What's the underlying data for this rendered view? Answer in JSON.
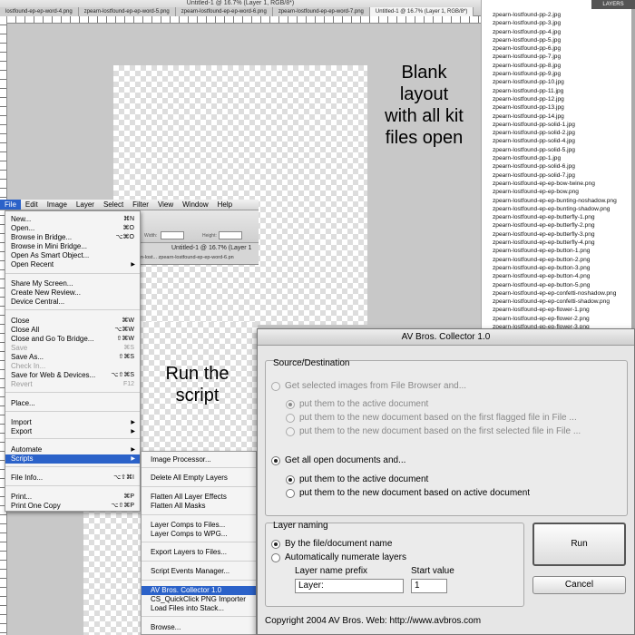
{
  "app": {
    "window_title": "Untitled-1 @ 16.7% (Layer 1, RGB/8*)",
    "tabs": [
      "lostfound-ep-ep-word-4.png",
      "zpearn-lostfound-ep-ep-word-5.png",
      "zpearn-lostfound-ep-ep-word-6.png",
      "zpearn-lostfound-ep-ep-word-7.png",
      "Untitled-1 @ 16.7% (Layer 1, RGB/8*)"
    ],
    "layers_tab": "LAYERS"
  },
  "annotations": {
    "blank_layout_lines": [
      "Blank",
      "layout",
      "with all kit",
      "files open"
    ],
    "run_script_lines": [
      "Run the",
      "script"
    ]
  },
  "open_files": [
    "zpearn-lostfound-pp-2.jpg",
    "zpearn-lostfound-pp-3.jpg",
    "zpearn-lostfound-pp-4.jpg",
    "zpearn-lostfound-pp-5.jpg",
    "zpearn-lostfound-pp-6.jpg",
    "zpearn-lostfound-pp-7.jpg",
    "zpearn-lostfound-pp-8.jpg",
    "zpearn-lostfound-pp-9.jpg",
    "zpearn-lostfound-pp-10.jpg",
    "zpearn-lostfound-pp-11.jpg",
    "zpearn-lostfound-pp-12.jpg",
    "zpearn-lostfound-pp-13.jpg",
    "zpearn-lostfound-pp-14.jpg",
    "zpearn-lostfound-pp-solid-1.jpg",
    "zpearn-lostfound-pp-solid-2.jpg",
    "zpearn-lostfound-pp-solid-4.jpg",
    "zpearn-lostfound-pp-solid-5.jpg",
    "zpearn-lostfound-pp-1.jpg",
    "zpearn-lostfound-pp-solid-6.jpg",
    "zpearn-lostfound-pp-solid-7.jpg",
    "zpearn-lostfound-ep-ep-bow-twine.png",
    "zpearn-lostfound-ep-ep-bow.png",
    "zpearn-lostfound-ep-ep-bunting-noshadow.png",
    "zpearn-lostfound-ep-ep-bunting-shadow.png",
    "zpearn-lostfound-ep-ep-butterfly-1.png",
    "zpearn-lostfound-ep-ep-butterfly-2.png",
    "zpearn-lostfound-ep-ep-butterfly-3.png",
    "zpearn-lostfound-ep-ep-butterfly-4.png",
    "zpearn-lostfound-ep-ep-button-1.png",
    "zpearn-lostfound-ep-ep-button-2.png",
    "zpearn-lostfound-ep-ep-button-3.png",
    "zpearn-lostfound-ep-ep-button-4.png",
    "zpearn-lostfound-ep-ep-button-5.png",
    "zpearn-lostfound-ep-ep-confetti-noshadow.png",
    "zpearn-lostfound-ep-ep-confetti-shadow.png",
    "zpearn-lostfound-ep-ep-flower-1.png",
    "zpearn-lostfound-ep-ep-flower-2.png",
    "zpearn-lostfound-ep-ep-flower-3.png",
    "zpearn-lostfound-ep-ep-flower-4.png",
    "zpearn-lostfound-ep-ep-flower-5.png",
    "zpearn-lostfound-ep-ep-flower-6.png"
  ],
  "menubar": [
    "File",
    "Edit",
    "Image",
    "Layer",
    "Select",
    "Filter",
    "View",
    "Window",
    "Help"
  ],
  "options_bar": {
    "width_label": "Width:",
    "height_label": "Height:"
  },
  "second_window": {
    "title": "Untitled-1 @ 16.7% (Layer 1",
    "tabs": "n-lost...  zpearn-lostfound-ep-ep-word-6.pn"
  },
  "file_menu": [
    {
      "label": "New...",
      "shortcut": "⌘N"
    },
    {
      "label": "Open...",
      "shortcut": "⌘O"
    },
    {
      "label": "Browse in Bridge...",
      "shortcut": "⌥⌘O"
    },
    {
      "label": "Browse in Mini Bridge..."
    },
    {
      "label": "Open As Smart Object..."
    },
    {
      "label": "Open Recent",
      "submenu": true
    },
    {
      "label": "Share My Screen..."
    },
    {
      "label": "Create New Review..."
    },
    {
      "label": "Device Central..."
    },
    {
      "label": "Close",
      "shortcut": "⌘W"
    },
    {
      "label": "Close All",
      "shortcut": "⌥⌘W"
    },
    {
      "label": "Close and Go To Bridge...",
      "shortcut": "⇧⌘W"
    },
    {
      "label": "Save",
      "shortcut": "⌘S",
      "disabled": true
    },
    {
      "label": "Save As...",
      "shortcut": "⇧⌘S"
    },
    {
      "label": "Check In...",
      "disabled": true
    },
    {
      "label": "Save for Web & Devices...",
      "shortcut": "⌥⇧⌘S"
    },
    {
      "label": "Revert",
      "shortcut": "F12",
      "disabled": true
    },
    {
      "label": "Place..."
    },
    {
      "label": "Import",
      "submenu": true
    },
    {
      "label": "Export",
      "submenu": true
    },
    {
      "label": "Automate",
      "submenu": true
    },
    {
      "label": "Scripts",
      "submenu": true,
      "selected": true
    },
    {
      "label": "File Info...",
      "shortcut": "⌥⇧⌘I"
    },
    {
      "label": "Print...",
      "shortcut": "⌘P"
    },
    {
      "label": "Print One Copy",
      "shortcut": "⌥⇧⌘P"
    }
  ],
  "scripts_menu": [
    "Image Processor...",
    "Delete All Empty Layers",
    "Flatten All Layer Effects",
    "Flatten All Masks",
    "Layer Comps to Files...",
    "Layer Comps to WPG...",
    "Export Layers to Files...",
    "Script Events Manager...",
    "AV Bros. Collector 1.0",
    "CS_QuickClick PNG Importer",
    "Load Files into Stack...",
    "Browse..."
  ],
  "dialog": {
    "title": "AV Bros. Collector 1.0",
    "source_legend": "Source/Destination",
    "opt_file_browser": "Get selected images from File Browser and...",
    "fb_sub": [
      "put them to the active document",
      "put them to the new document based on the first flagged file in File ...",
      "put them to the new document based on the first selected file in File ..."
    ],
    "opt_open_docs": "Get all open documents and...",
    "od_sub": [
      "put them to the active document",
      "put them to the new document based on active document"
    ],
    "naming_legend": "Layer naming",
    "naming_opts": [
      "By the file/document name",
      "Automatically numerate layers"
    ],
    "prefix_label": "Layer name prefix",
    "prefix_value": "Layer:",
    "start_label": "Start value",
    "start_value": "1",
    "run_label": "Run",
    "cancel_label": "Cancel",
    "copyright": "Copyright 2004 AV Bros.   Web: http://www.avbros.com"
  }
}
